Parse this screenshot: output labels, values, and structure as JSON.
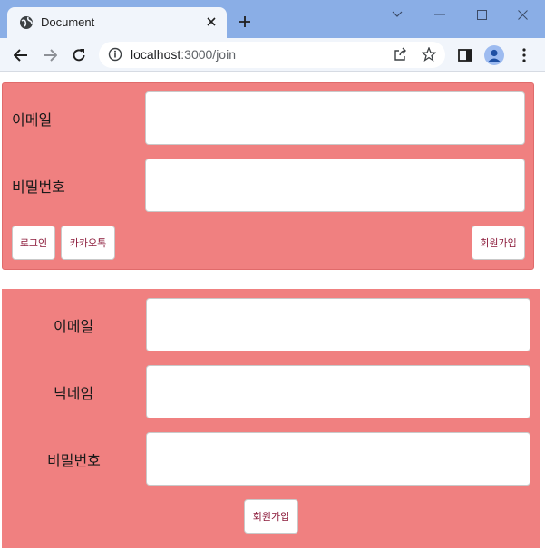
{
  "browser": {
    "tab_title": "Document",
    "url_host": "localhost",
    "url_path": ":3000/join"
  },
  "login_form": {
    "email_label": "이메일",
    "password_label": "비밀번호",
    "login_button": "로그인",
    "kakao_button": "카카오톡",
    "signup_button": "회원가입"
  },
  "join_form": {
    "email_label": "이메일",
    "nickname_label": "닉네임",
    "password_label": "비밀번호",
    "signup_button": "회원가입"
  }
}
